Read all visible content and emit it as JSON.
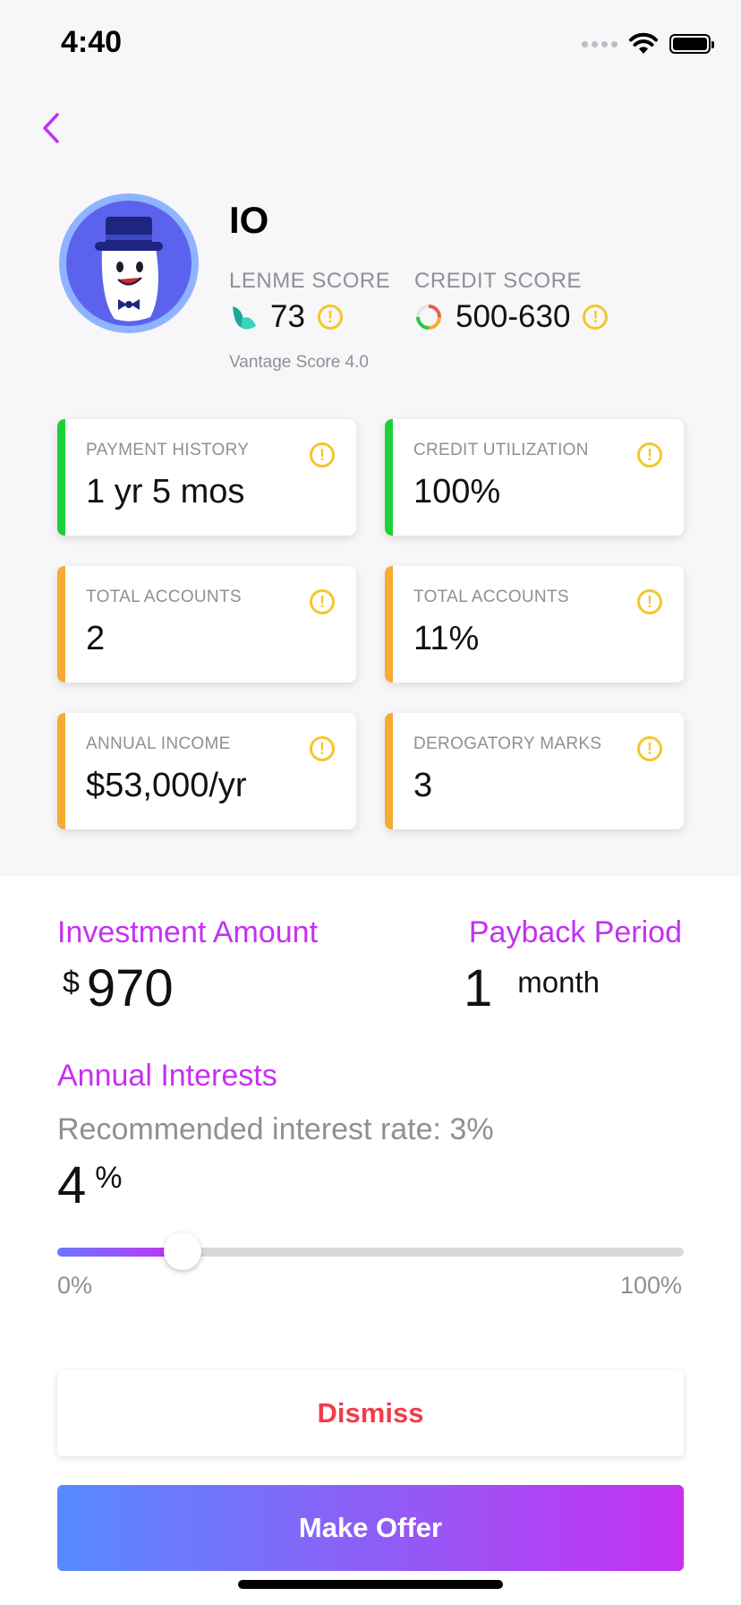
{
  "status_bar": {
    "time": "4:40"
  },
  "profile": {
    "name": "IO",
    "lenme_score": {
      "label": "LENME SCORE",
      "value": "73"
    },
    "credit_score": {
      "label": "CREDIT SCORE",
      "value": "500-630"
    },
    "vantage_note": "Vantage Score 4.0"
  },
  "cards": [
    {
      "label": "PAYMENT HISTORY",
      "value": "1 yr 5 mos",
      "status_color": "#1fcf3a"
    },
    {
      "label": "CREDIT UTILIZATION",
      "value": "100%",
      "status_color": "#1fcf3a"
    },
    {
      "label": "TOTAL ACCOUNTS",
      "value": "2",
      "status_color": "#f7ab33"
    },
    {
      "label": "TOTAL ACCOUNTS",
      "value": "11%",
      "status_color": "#f7ab33"
    },
    {
      "label": "ANNUAL INCOME",
      "value": "$53,000/yr",
      "status_color": "#f7ab33"
    },
    {
      "label": "DEROGATORY MARKS",
      "value": "3",
      "status_color": "#f7ab33"
    }
  ],
  "investment": {
    "label": "Investment Amount",
    "currency": "$",
    "value": "970"
  },
  "payback": {
    "label": "Payback Period",
    "value": "1",
    "unit": "month"
  },
  "interest": {
    "label": "Annual Interests",
    "recommended": "Recommended interest rate: 3%",
    "value": "4",
    "unit": "%",
    "slider": {
      "min_label": "0%",
      "max_label": "100%",
      "level": 0.2
    }
  },
  "buttons": {
    "dismiss": "Dismiss",
    "make_offer": "Make Offer"
  },
  "colors": {
    "accent": "#c531f0",
    "gradient_start": "#568bff",
    "gradient_end": "#c531f0",
    "dismiss_text": "#f23c4b",
    "warning": "#f5c62b",
    "status_good": "#1fcf3a",
    "status_mid": "#f7ab33"
  }
}
